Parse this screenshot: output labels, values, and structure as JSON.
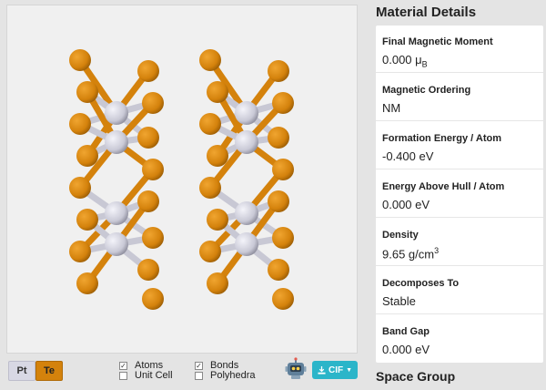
{
  "viewer": {
    "elements": [
      {
        "symbol": "Pt",
        "color": "#c9c9d6"
      },
      {
        "symbol": "Te",
        "color": "#d4820c"
      }
    ],
    "options": {
      "atoms": {
        "label": "Atoms",
        "checked": true
      },
      "unit_cell": {
        "label": "Unit Cell",
        "checked": false
      },
      "bonds": {
        "label": "Bonds",
        "checked": true
      },
      "polyhedra": {
        "label": "Polyhedra",
        "checked": false
      }
    },
    "export_label": "CIF",
    "robot_icon": "robot-icon"
  },
  "details": {
    "title": "Material Details",
    "rows": [
      {
        "label": "Final Magnetic Moment",
        "value": "0.000 μ",
        "sub": "B"
      },
      {
        "label": "Magnetic Ordering",
        "value": "NM"
      },
      {
        "label": "Formation Energy / Atom",
        "value": "-0.400 eV"
      },
      {
        "label": "Energy Above Hull / Atom",
        "value": "0.000 eV"
      },
      {
        "label": "Density",
        "value": "9.65 g/cm",
        "sup": "3"
      },
      {
        "label": "Decomposes To",
        "value": "Stable"
      },
      {
        "label": "Band Gap",
        "value": "0.000 eV"
      }
    ]
  },
  "space_group": {
    "title": "Space Group"
  }
}
